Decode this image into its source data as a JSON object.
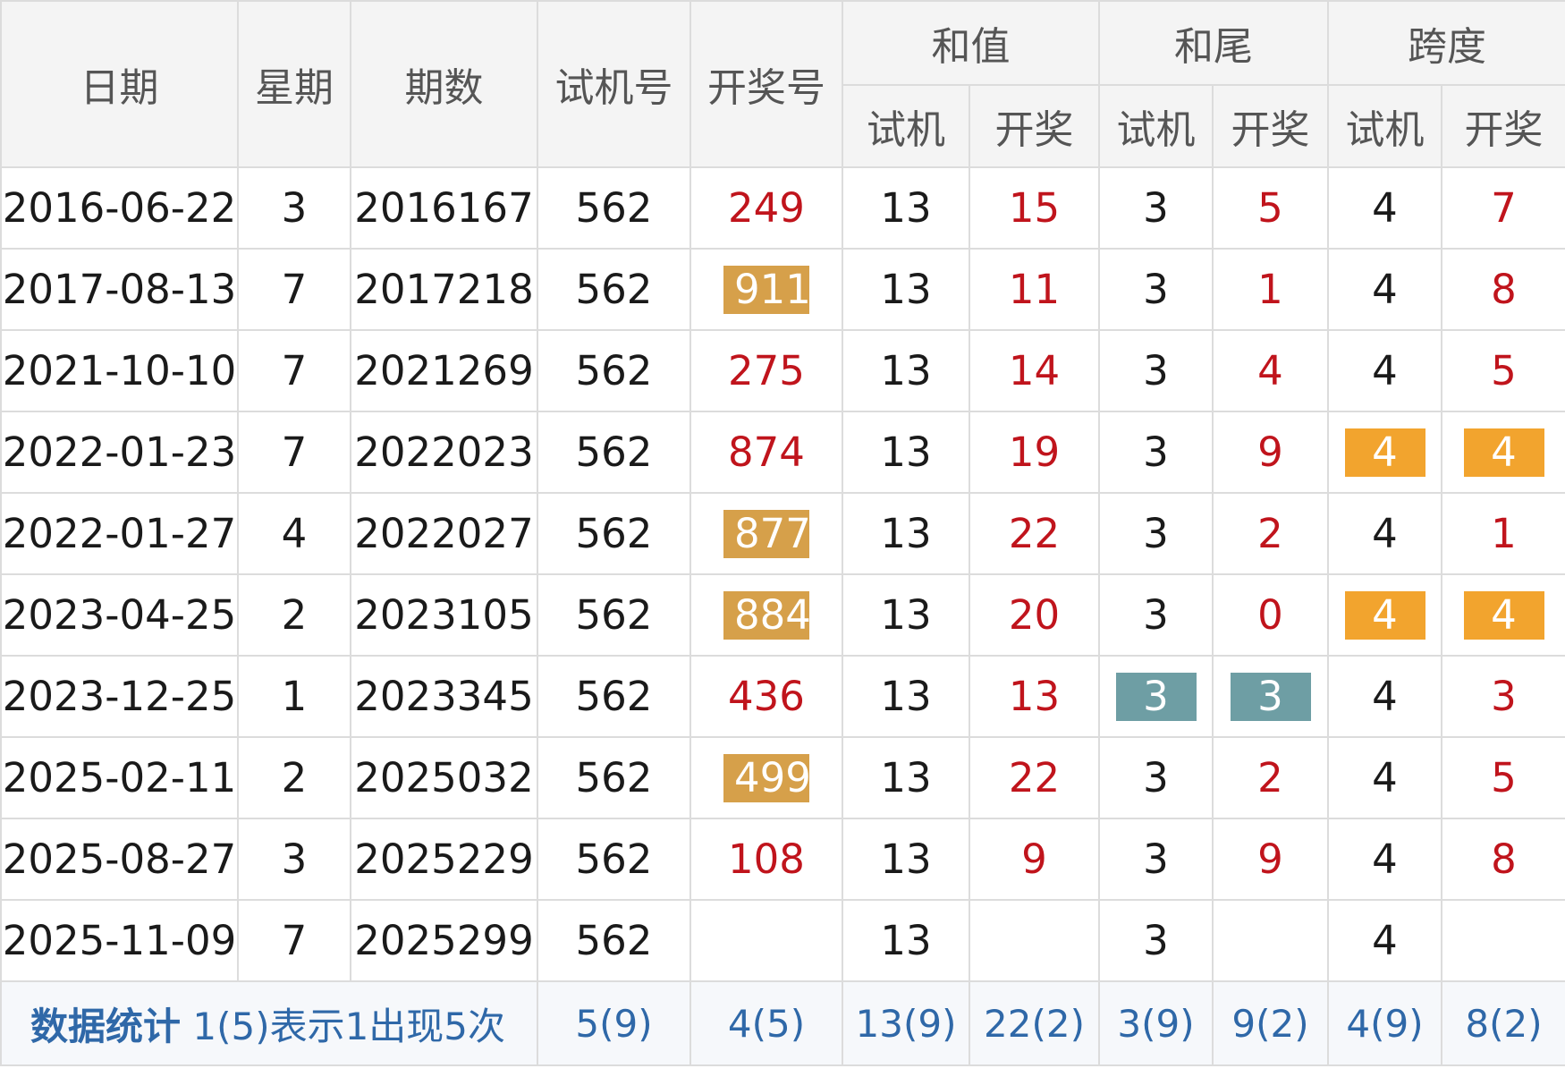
{
  "headers": {
    "date": "日期",
    "weekday": "星期",
    "issue": "期数",
    "trial": "试机号",
    "draw": "开奖号",
    "sum": "和值",
    "sum_tail": "和尾",
    "span": "跨度",
    "sub_trial": "试机",
    "sub_draw": "开奖"
  },
  "rows": [
    {
      "date": "2016-06-22",
      "weekday": "3",
      "issue": "2016167",
      "trial": "562",
      "draw": "249",
      "sum_trial": "13",
      "sum_draw": "15",
      "tail_trial": "3",
      "tail_draw": "5",
      "span_trial": "4",
      "span_draw": "7"
    },
    {
      "date": "2017-08-13",
      "weekday": "7",
      "issue": "2017218",
      "trial": "562",
      "draw": "911",
      "sum_trial": "13",
      "sum_draw": "11",
      "tail_trial": "3",
      "tail_draw": "1",
      "span_trial": "4",
      "span_draw": "8"
    },
    {
      "date": "2021-10-10",
      "weekday": "7",
      "issue": "2021269",
      "trial": "562",
      "draw": "275",
      "sum_trial": "13",
      "sum_draw": "14",
      "tail_trial": "3",
      "tail_draw": "4",
      "span_trial": "4",
      "span_draw": "5"
    },
    {
      "date": "2022-01-23",
      "weekday": "7",
      "issue": "2022023",
      "trial": "562",
      "draw": "874",
      "sum_trial": "13",
      "sum_draw": "19",
      "tail_trial": "3",
      "tail_draw": "9",
      "span_trial": "4",
      "span_draw": "4"
    },
    {
      "date": "2022-01-27",
      "weekday": "4",
      "issue": "2022027",
      "trial": "562",
      "draw": "877",
      "sum_trial": "13",
      "sum_draw": "22",
      "tail_trial": "3",
      "tail_draw": "2",
      "span_trial": "4",
      "span_draw": "1"
    },
    {
      "date": "2023-04-25",
      "weekday": "2",
      "issue": "2023105",
      "trial": "562",
      "draw": "884",
      "sum_trial": "13",
      "sum_draw": "20",
      "tail_trial": "3",
      "tail_draw": "0",
      "span_trial": "4",
      "span_draw": "4"
    },
    {
      "date": "2023-12-25",
      "weekday": "1",
      "issue": "2023345",
      "trial": "562",
      "draw": "436",
      "sum_trial": "13",
      "sum_draw": "13",
      "tail_trial": "3",
      "tail_draw": "3",
      "span_trial": "4",
      "span_draw": "3"
    },
    {
      "date": "2025-02-11",
      "weekday": "2",
      "issue": "2025032",
      "trial": "562",
      "draw": "499",
      "sum_trial": "13",
      "sum_draw": "22",
      "tail_trial": "3",
      "tail_draw": "2",
      "span_trial": "4",
      "span_draw": "5"
    },
    {
      "date": "2025-08-27",
      "weekday": "3",
      "issue": "2025229",
      "trial": "562",
      "draw": "108",
      "sum_trial": "13",
      "sum_draw": "9",
      "tail_trial": "3",
      "tail_draw": "9",
      "span_trial": "4",
      "span_draw": "8"
    },
    {
      "date": "2025-11-09",
      "weekday": "7",
      "issue": "2025299",
      "trial": "562",
      "draw": "",
      "sum_trial": "13",
      "sum_draw": "",
      "tail_trial": "3",
      "tail_draw": "",
      "span_trial": "4",
      "span_draw": ""
    }
  ],
  "footer": {
    "label_bold": "数据统计",
    "label_note": "1(5)表示1出现5次",
    "trial": "5(9)",
    "draw": "4(5)",
    "sum_trial": "13(9)",
    "sum_draw": "22(2)",
    "tail_trial": "3(9)",
    "tail_draw": "9(2)",
    "span_trial": "4(9)",
    "span_draw": "8(2)"
  },
  "colors": {
    "draw_text": "#c0141c",
    "highlight_pair": "#d6a04a",
    "highlight_span_repeat": "#f2a42e",
    "highlight_tail_repeat": "#6e9ea4",
    "footer_text": "#2f68a8"
  }
}
